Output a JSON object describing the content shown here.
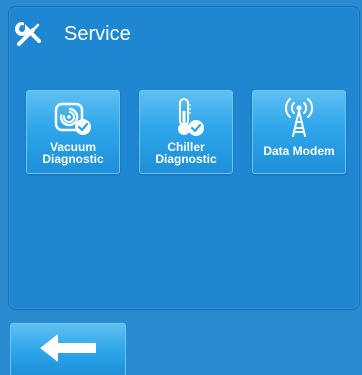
{
  "header": {
    "title": "Service",
    "icon": "tools-icon"
  },
  "tiles": [
    {
      "label_line1": "Vacuum",
      "label_line2": "Diagnostic",
      "icon": "vacuum-icon"
    },
    {
      "label_line1": "Chiller",
      "label_line2": "Diagnostic",
      "icon": "thermometer-icon"
    },
    {
      "label_line1": "Data Modem",
      "icon": "antenna-icon"
    }
  ],
  "footer": {
    "back_icon": "back-arrow-icon"
  },
  "colors": {
    "background": "#2a8ad0",
    "tile_top": "#5fc0f2",
    "tile_bottom": "#1e8fd8",
    "text": "#ffffff"
  }
}
